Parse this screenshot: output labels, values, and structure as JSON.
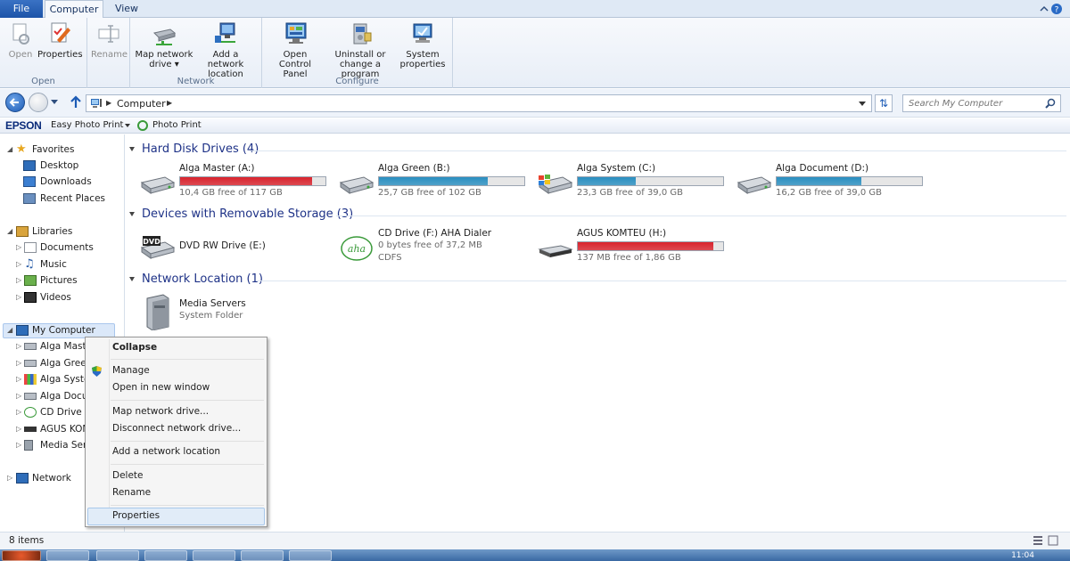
{
  "ribbon": {
    "tabs": {
      "file": "File",
      "computer": "Computer",
      "view": "View"
    },
    "groups": {
      "open": {
        "label": "Open",
        "open": "Open",
        "properties": "Properties"
      },
      "rename": {
        "rename": "Rename"
      },
      "network": {
        "label": "Network",
        "map_line1": "Map network",
        "map_line2": "drive ▾",
        "add_line1": "Add a network",
        "add_line2": "location"
      },
      "configure": {
        "label": "Configure",
        "cp_line1": "Open Control",
        "cp_line2": "Panel",
        "un_line1": "Uninstall or",
        "un_line2": "change a program",
        "sys_line1": "System",
        "sys_line2": "properties"
      }
    }
  },
  "address": {
    "crumb": "Computer",
    "search_placeholder": "Search My Computer"
  },
  "epson": {
    "logo": "EPSON",
    "app": "Easy Photo Print",
    "photo_print": "Photo Print"
  },
  "nav": {
    "favorites": "Favorites",
    "desktop": "Desktop",
    "downloads": "Downloads",
    "recent": "Recent Places",
    "libraries": "Libraries",
    "documents": "Documents",
    "music": "Music",
    "pictures": "Pictures",
    "videos": "Videos",
    "my_computer": "My Computer",
    "children": [
      "Alga Maste",
      "Alga Green",
      "Alga Systen",
      "Alga Docun",
      "CD Drive (F",
      "AGUS KOM",
      "Media Serv"
    ],
    "network": "Network"
  },
  "sections": {
    "hdd": "Hard Disk Drives (4)",
    "removable": "Devices with Removable Storage (3)",
    "network": "Network Location (1)"
  },
  "hard_drives": [
    {
      "name": "Alga Master (A:)",
      "free": "10,4 GB free of 117 GB",
      "used_fraction": 0.91,
      "color": "#d9232d"
    },
    {
      "name": "Alga Green (B:)",
      "free": "25,7 GB free of 102 GB",
      "used_fraction": 0.75,
      "color": "#2a8fc1"
    },
    {
      "name": "Alga System (C:)",
      "free": "23,3 GB free of 39,0 GB",
      "used_fraction": 0.4,
      "color": "#2a8fc1"
    },
    {
      "name": "Alga Document (D:)",
      "free": "16,2 GB free of 39,0 GB",
      "used_fraction": 0.58,
      "color": "#2a8fc1"
    }
  ],
  "removable": {
    "dvd": {
      "name": "DVD RW Drive (E:)",
      "icon_label": "DVD"
    },
    "cd": {
      "name": "CD Drive (F:) AHA Dialer",
      "free": "0 bytes free of 37,2 MB",
      "fs": "CDFS",
      "icon_label": "aha"
    },
    "usb": {
      "name": "AGUS KOMTEU (H:)",
      "free": "137 MB free of 1,86 GB",
      "used_fraction": 0.93,
      "color": "#d9232d"
    }
  },
  "network_location": {
    "name": "Media Servers",
    "type": "System Folder"
  },
  "context_menu": {
    "collapse": "Collapse",
    "manage": "Manage",
    "open_new": "Open in new window",
    "map": "Map network drive...",
    "disconnect": "Disconnect network drive...",
    "add_location": "Add a network location",
    "delete": "Delete",
    "rename": "Rename",
    "properties": "Properties"
  },
  "status": {
    "items": "8 items"
  },
  "taskbar": {
    "clock": "11:04"
  }
}
